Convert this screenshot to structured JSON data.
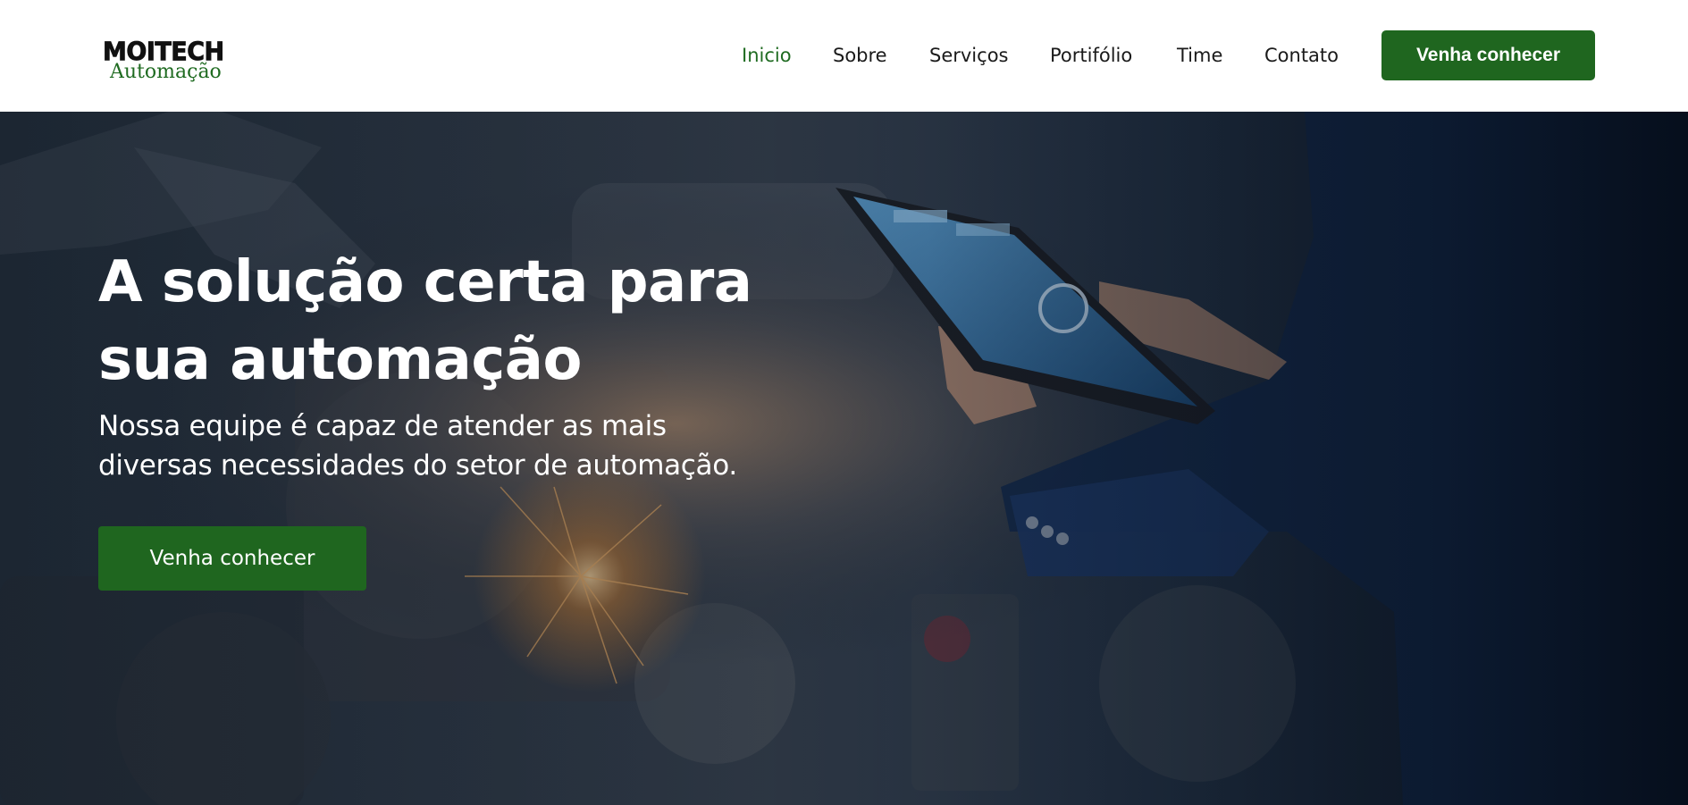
{
  "brand": {
    "name_top": "MOITECH",
    "name_bottom": "Automação",
    "accent_color": "#1f661f"
  },
  "nav": {
    "items": [
      {
        "label": "Inicio",
        "active": true
      },
      {
        "label": "Sobre",
        "active": false
      },
      {
        "label": "Serviços",
        "active": false
      },
      {
        "label": "Portifólio",
        "active": false
      },
      {
        "label": "Time",
        "active": false
      },
      {
        "label": "Contato",
        "active": false
      }
    ],
    "cta_label": "Venha conhecer"
  },
  "hero": {
    "title_line1": "A solução certa para",
    "title_line2": "sua automação",
    "subtitle_line1": "Nossa equipe é capaz de atender as mais",
    "subtitle_line2": "diversas necessidades do setor de automação.",
    "cta_label": "Venha conhecer",
    "background": "industrial-automation-photo"
  }
}
